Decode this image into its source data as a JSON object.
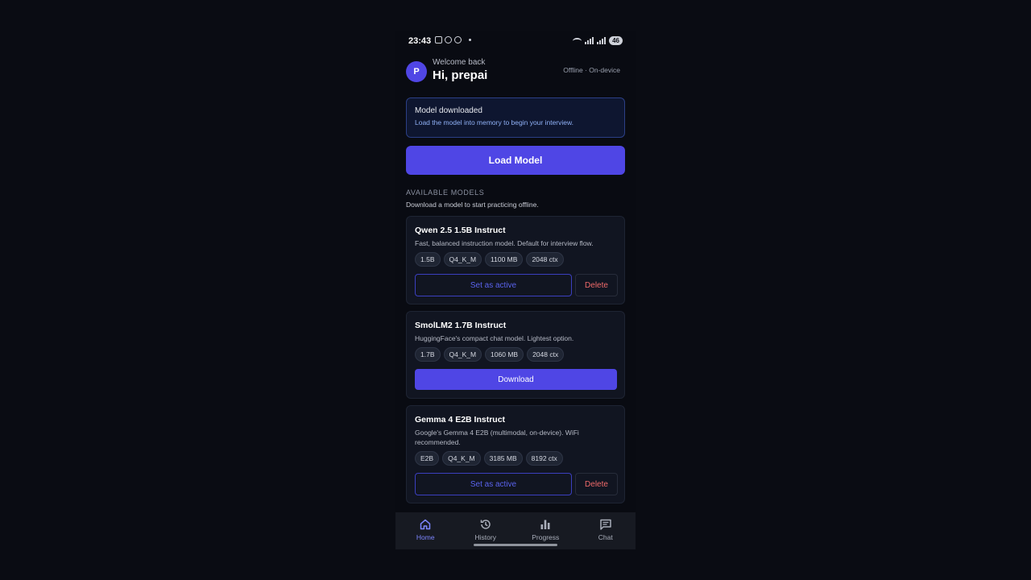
{
  "status_bar": {
    "time": "23:43",
    "battery": "46"
  },
  "header": {
    "avatar_initial": "P",
    "welcome": "Welcome back",
    "greeting": "Hi, prepai",
    "mode": "Offline · On-device"
  },
  "notice": {
    "title": "Model downloaded",
    "subtitle": "Load the model into memory to begin your interview."
  },
  "load_button": "Load Model",
  "section": {
    "title": "AVAILABLE MODELS",
    "subtitle": "Download a model to start practicing offline."
  },
  "models": [
    {
      "name": "Qwen 2.5 1.5B Instruct",
      "description": "Fast, balanced instruction model. Default for interview flow.",
      "chips": [
        "1.5B",
        "Q4_K_M",
        "1100 MB",
        "2048 ctx"
      ],
      "primary_action": "Set as active",
      "secondary_action": "Delete"
    },
    {
      "name": "SmolLM2 1.7B Instruct",
      "description": "HuggingFace's compact chat model. Lightest option.",
      "chips": [
        "1.7B",
        "Q4_K_M",
        "1060 MB",
        "2048 ctx"
      ],
      "primary_action": "Download"
    },
    {
      "name": "Gemma 4 E2B Instruct",
      "description": "Google's Gemma 4 E2B (multimodal, on-device). WiFi recommended.",
      "chips": [
        "E2B",
        "Q4_K_M",
        "3185 MB",
        "8192 ctx"
      ],
      "primary_action": "Set as active",
      "secondary_action": "Delete"
    }
  ],
  "nav": [
    {
      "label": "Home",
      "icon": "home-icon",
      "active": true
    },
    {
      "label": "History",
      "icon": "history-icon",
      "active": false
    },
    {
      "label": "Progress",
      "icon": "bar-chart-icon",
      "active": false
    },
    {
      "label": "Chat",
      "icon": "chat-icon",
      "active": false
    }
  ],
  "colors": {
    "accent": "#4f46e5",
    "danger": "#f06a6a",
    "background": "#090b12",
    "card": "#111521"
  }
}
